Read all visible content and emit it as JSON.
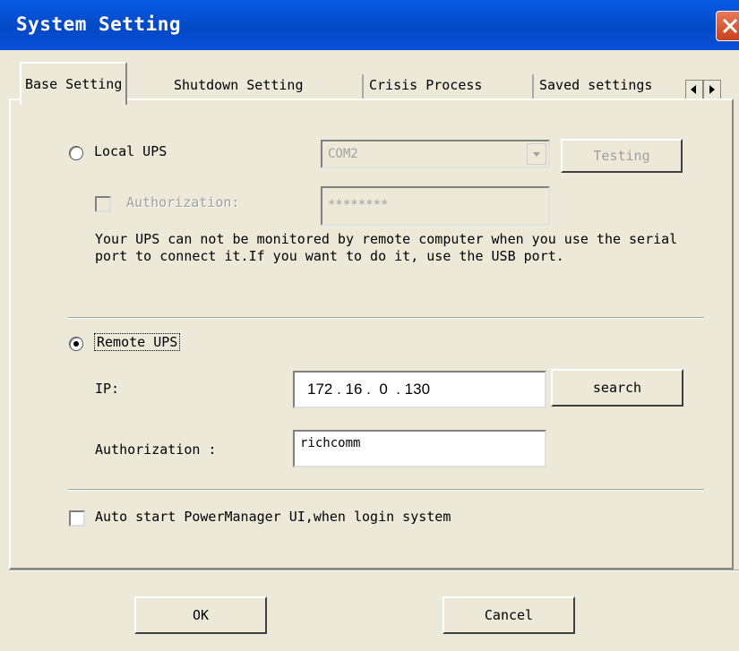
{
  "window": {
    "title": "System Setting"
  },
  "tabs": [
    {
      "label": "Base Setting"
    },
    {
      "label": "Shutdown Setting"
    },
    {
      "label": "Crisis Process"
    },
    {
      "label": "Saved settings"
    }
  ],
  "local_ups": {
    "label": "Local UPS",
    "port_value": "COM2",
    "testing_label": "Testing",
    "authorization_label": "Authorization:",
    "authorization_value": "********",
    "note": "Your UPS can not be monitored by remote computer when you use the serial port to connect it.If you want to do it, use the USB port."
  },
  "remote_ups": {
    "label": "Remote UPS",
    "ip_label": "IP:",
    "ip_value": "172 . 16 .  0  . 130",
    "search_label": "search",
    "authorization_label": "Authorization :",
    "authorization_value": "richcomm"
  },
  "autostart_label": "Auto start PowerManager UI,when login system",
  "footer": {
    "ok_label": "OK",
    "cancel_label": "Cancel"
  }
}
